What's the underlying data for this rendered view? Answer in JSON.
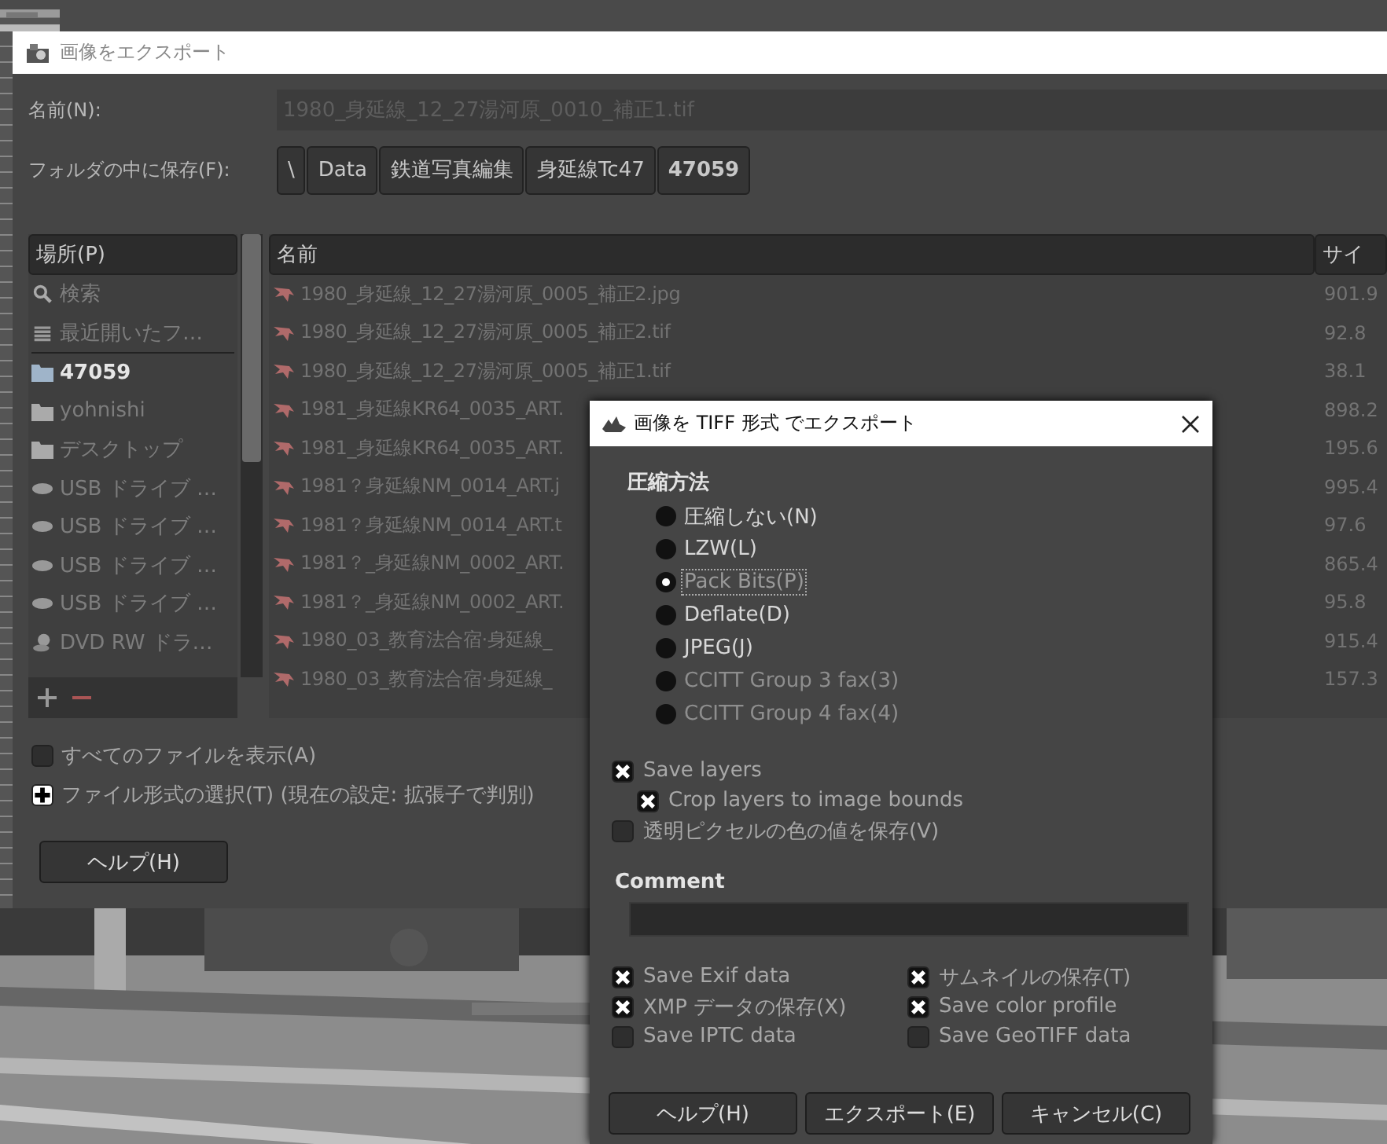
{
  "export_dialog": {
    "title": "画像をエクスポート",
    "name_label": "名前(N):",
    "name_value": "1980_身延線_12_27湯河原_0010_補正1.tif",
    "folder_label": "フォルダの中に保存(F):",
    "path": [
      {
        "label": "\\",
        "selected": false
      },
      {
        "label": "Data",
        "selected": false
      },
      {
        "label": "鉄道写真編集",
        "selected": false
      },
      {
        "label": "身延線Tc47",
        "selected": false
      },
      {
        "label": "47059",
        "selected": true
      }
    ],
    "places": {
      "header": "場所(P)",
      "items": [
        {
          "label": "検索",
          "kind": "search",
          "selected": false
        },
        {
          "label": "最近開いたフ…",
          "kind": "recent",
          "selected": false
        },
        {
          "label": "47059",
          "kind": "folder",
          "selected": true
        },
        {
          "label": "yohnishi",
          "kind": "folder",
          "selected": false
        },
        {
          "label": "デスクトップ",
          "kind": "folder",
          "selected": false
        },
        {
          "label": "USB ドライブ …",
          "kind": "drive",
          "selected": false
        },
        {
          "label": "USB ドライブ …",
          "kind": "drive",
          "selected": false
        },
        {
          "label": "USB ドライブ …",
          "kind": "drive",
          "selected": false
        },
        {
          "label": "USB ドライブ …",
          "kind": "drive",
          "selected": false
        },
        {
          "label": "DVD RW ドラ…",
          "kind": "disc",
          "selected": false
        }
      ]
    },
    "files": {
      "name_header": "名前",
      "size_header": "サイ",
      "rows": [
        {
          "name": "1980_身延線_12_27湯河原_0005_補正2.jpg",
          "size": "901.9"
        },
        {
          "name": "1980_身延線_12_27湯河原_0005_補正2.tif",
          "size": "92.8"
        },
        {
          "name": "1980_身延線_12_27湯河原_0005_補正1.tif",
          "size": "38.1"
        },
        {
          "name": "1981_身延線KR64_0035_ART.",
          "size": "898.2"
        },
        {
          "name": "1981_身延線KR64_0035_ART.",
          "size": "195.6"
        },
        {
          "name": "1981？身延線NM_0014_ART.j",
          "size": "995.4"
        },
        {
          "name": "1981？身延線NM_0014_ART.t",
          "size": "97.6"
        },
        {
          "name": "1981？_身延線NM_0002_ART.",
          "size": "865.4"
        },
        {
          "name": "1981？_身延線NM_0002_ART.",
          "size": "95.8"
        },
        {
          "name": "1980_03_教育法合宿·身延線_",
          "size": "915.4"
        },
        {
          "name": "1980_03_教育法合宿·身延線_",
          "size": "157.3"
        }
      ]
    },
    "show_all": {
      "label": "すべてのファイルを表示(A)",
      "checked": false
    },
    "file_type": {
      "label": "ファイル形式の選択(T) (現在の設定: 拡張子で判別)",
      "expanded": false
    },
    "help_button": "ヘルプ(H)"
  },
  "tiff_dialog": {
    "title": "画像を TIFF 形式 でエクスポート",
    "compression_heading": "圧縮方法",
    "compression": [
      {
        "label": "圧縮しない(N)",
        "selected": false,
        "disabled": false
      },
      {
        "label": "LZW(L)",
        "selected": false,
        "disabled": false
      },
      {
        "label": "Pack Bits(P)",
        "selected": true,
        "disabled": false
      },
      {
        "label": "Deflate(D)",
        "selected": false,
        "disabled": false
      },
      {
        "label": "JPEG(J)",
        "selected": false,
        "disabled": false
      },
      {
        "label": "CCITT Group 3 fax(3)",
        "selected": false,
        "disabled": true
      },
      {
        "label": "CCITT Group 4 fax(4)",
        "selected": false,
        "disabled": true
      }
    ],
    "layer_options": [
      {
        "label": "Save layers",
        "checked": true,
        "children": [
          {
            "label": "Crop layers to image bounds",
            "checked": true
          }
        ]
      },
      {
        "label": "透明ピクセルの色の値を保存(V)",
        "checked": false
      }
    ],
    "comment_label": "Comment",
    "metadata": [
      {
        "label": "Save Exif data",
        "checked": true
      },
      {
        "label": "サムネイルの保存(T)",
        "checked": true
      },
      {
        "label": "XMP データの保存(X)",
        "checked": true
      },
      {
        "label": "Save color profile",
        "checked": true
      },
      {
        "label": "Save IPTC data",
        "checked": false
      },
      {
        "label": "Save GeoTIFF data",
        "checked": false
      }
    ],
    "buttons": [
      "ヘルプ(H)",
      "エクスポート(E)",
      "キャンセル(C)"
    ]
  }
}
